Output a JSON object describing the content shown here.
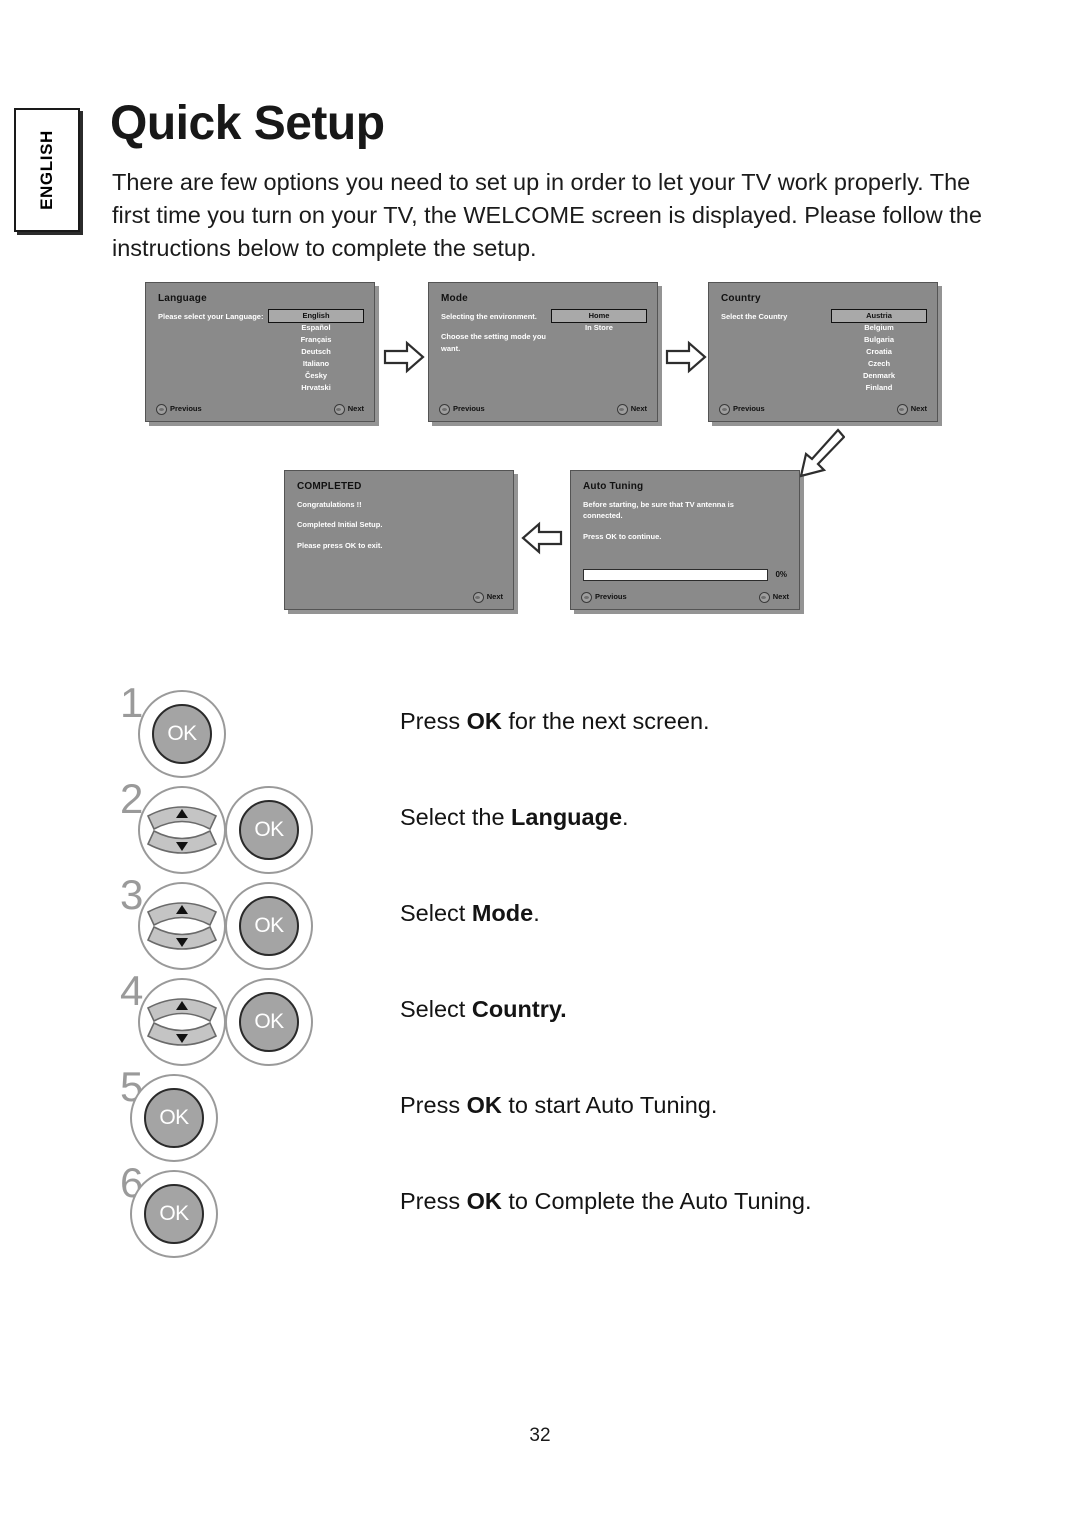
{
  "sidebar": {
    "language_tab": "ENGLISH"
  },
  "header": {
    "title": "Quick Setup",
    "intro": "There are few options you need to set up in order to let your TV work properly. The first time you turn on your TV, the WELCOME screen is displayed. Please follow the instructions below to complete the setup."
  },
  "osd_panels": {
    "language": {
      "title": "Language",
      "prompt": "Please select your Language:",
      "options": [
        "English",
        "Español",
        "Français",
        "Deutsch",
        "Italiano",
        "Česky",
        "Hrvatski"
      ],
      "selected": "English",
      "prev_label": "Previous",
      "next_label": "Next"
    },
    "mode": {
      "title": "Mode",
      "line1": "Selecting the environment.",
      "line2": "Choose the setting mode you want.",
      "options": [
        "Home",
        "In Store"
      ],
      "selected": "Home",
      "prev_label": "Previous",
      "next_label": "Next"
    },
    "country": {
      "title": "Country",
      "prompt": "Select the Country",
      "options": [
        "Austria",
        "Belgium",
        "Bulgaria",
        "Croatia",
        "Czech",
        "Denmark",
        "Finland"
      ],
      "selected": "Austria",
      "prev_label": "Previous",
      "next_label": "Next"
    },
    "auto_tuning": {
      "title": "Auto Tuning",
      "line1": "Before starting, be sure that TV antenna is connected.",
      "line2": "Press OK to continue.",
      "progress": "0%",
      "prev_label": "Previous",
      "next_label": "Next"
    },
    "completed": {
      "title": "COMPLETED",
      "line1": "Congratulations !!",
      "line2": "Completed Initial Setup.",
      "line3": "Please press OK to exit.",
      "next_label": "Next"
    }
  },
  "flow_arrows": [
    {
      "name": "arrow-language-to-mode",
      "direction": "right"
    },
    {
      "name": "arrow-mode-to-country",
      "direction": "right"
    },
    {
      "name": "arrow-country-to-autotuning",
      "direction": "down-left"
    },
    {
      "name": "arrow-autotuning-to-completed",
      "direction": "left"
    }
  ],
  "steps": [
    {
      "number": "1",
      "buttons": [
        "ok"
      ],
      "ok_label": "OK",
      "text_pre": "Press ",
      "text_bold": "OK",
      "text_post": " for the next screen."
    },
    {
      "number": "2",
      "buttons": [
        "updown",
        "ok"
      ],
      "ok_label": "OK",
      "text_pre": "Select the ",
      "text_bold": "Language",
      "text_post": "."
    },
    {
      "number": "3",
      "buttons": [
        "updown",
        "ok"
      ],
      "ok_label": "OK",
      "text_pre": "Select ",
      "text_bold": "Mode",
      "text_post": "."
    },
    {
      "number": "4",
      "buttons": [
        "updown",
        "ok"
      ],
      "ok_label": "OK",
      "text_pre": "Select ",
      "text_bold": "Country.",
      "text_post": ""
    },
    {
      "number": "5",
      "buttons": [
        "ok"
      ],
      "ok_label": "OK",
      "text_pre": "Press ",
      "text_bold": "OK",
      "text_post": " to start Auto Tuning."
    },
    {
      "number": "6",
      "buttons": [
        "ok"
      ],
      "ok_label": "OK",
      "text_pre": "Press ",
      "text_bold": "OK",
      "text_post": " to Complete the Auto Tuning."
    }
  ],
  "footer": {
    "page_number": "32"
  },
  "colors": {
    "osd_background": "#8a8a8a",
    "osd_selected": "#a9a9a9",
    "step_number": "#9a9a9a",
    "ok_button": "#a4a4a4"
  }
}
